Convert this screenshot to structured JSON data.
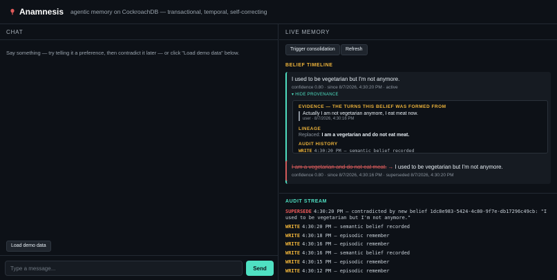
{
  "header": {
    "title": "Anamnesis",
    "subtitle": "agentic memory on CockroachDB — transactional, temporal, self-correcting"
  },
  "chat": {
    "heading": "CHAT",
    "hint": "Say something — try telling it a preference, then contradict it later — or click \"Load demo data\" below.",
    "demo_button": "Load demo data",
    "input_placeholder": "Type a message...",
    "input_value": "",
    "send_button": "Send"
  },
  "memory": {
    "heading": "LIVE MEMORY",
    "trigger_button": "Trigger consolidation",
    "refresh_button": "Refresh",
    "timeline_heading": "BELIEF TIMELINE",
    "active_belief": {
      "text": "I used to be vegetarian but I'm not anymore.",
      "meta": "confidence 0.80 · since 8/7/2026, 4:30:20 PM · active",
      "toggle": "▾ HIDE PROVENANCE",
      "evidence_heading": "EVIDENCE — THE TURNS THIS BELIEF WAS FORMED FROM",
      "evidence_text": "Actually I am not vegetarian anymore, I eat meat now.",
      "evidence_meta": "user · 8/7/2026, 4:30:16 PM",
      "lineage_heading": "LINEAGE",
      "lineage_label": "Replaced:",
      "lineage_value": "I am a vegetarian and do not eat meat.",
      "audit_heading": "AUDIT HISTORY",
      "audit_kw": "WRITE",
      "audit_text": "4:30:20 PM — semantic belief recorded"
    },
    "superseded_belief": {
      "old_text": "I am a vegetarian and do not eat meat.",
      "arrow": "→",
      "new_text": "I used to be vegetarian but I'm not anymore.",
      "meta": "confidence 0.80 · since 8/7/2026, 4:30:16 PM · superseded 8/7/2026, 4:30:20 PM"
    },
    "stream_heading": "AUDIT STREAM",
    "stream": [
      {
        "kw": "SUPERSEDE",
        "text": "4:30:20 PM — contradicted by new belief 1dc8e983-5424-4c80-9f7e-db17296c49cb: \"I used to be vegetarian but I'm not anymore.\""
      },
      {
        "kw": "WRITE",
        "text": "4:30:20 PM — semantic belief recorded"
      },
      {
        "kw": "WRITE",
        "text": "4:30:18 PM — episodic remember"
      },
      {
        "kw": "WRITE",
        "text": "4:30:16 PM — episodic remember"
      },
      {
        "kw": "WRITE",
        "text": "4:30:16 PM — semantic belief recorded"
      },
      {
        "kw": "WRITE",
        "text": "4:30:15 PM — episodic remember"
      },
      {
        "kw": "WRITE",
        "text": "4:30:12 PM — episodic remember"
      }
    ]
  },
  "colors": {
    "accent": "#4fe0c2",
    "warning": "#f0b53a",
    "danger": "#ef5a5a",
    "background": "#0d1117"
  },
  "icons": {
    "logo": "brain-icon"
  }
}
